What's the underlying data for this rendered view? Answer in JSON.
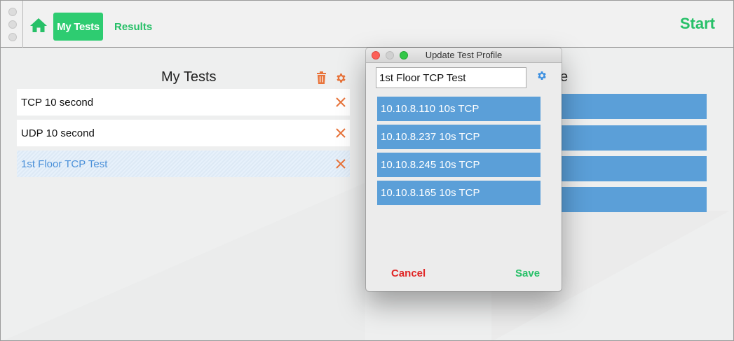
{
  "toolbar": {
    "home_icon": "home-icon",
    "tabs": [
      {
        "label": "My Tests",
        "active": true
      },
      {
        "label": "Results",
        "active": false
      }
    ],
    "start_label": "Start"
  },
  "my_tests": {
    "title": "My Tests",
    "rows": [
      {
        "label": "TCP 10 second",
        "selected": false
      },
      {
        "label": "UDP 10 second",
        "selected": false
      },
      {
        "label": "1st Floor TCP Test",
        "selected": true
      }
    ]
  },
  "right_panel": {
    "title_fragment": "e",
    "row_count": 4
  },
  "dialog": {
    "title": "Update Test Profile",
    "name_value": "1st Floor TCP Test",
    "servers": [
      "10.10.8.110 10s TCP",
      "10.10.8.237 10s TCP",
      "10.10.8.245 10s TCP",
      "10.10.8.165 10s TCP"
    ],
    "cancel_label": "Cancel",
    "save_label": "Save"
  },
  "colors": {
    "accent_green": "#2ecc71",
    "list_blue": "#5b9fd8",
    "cancel_red": "#e02424",
    "icon_orange": "#e8743b",
    "gear_blue": "#3b8fe0"
  }
}
